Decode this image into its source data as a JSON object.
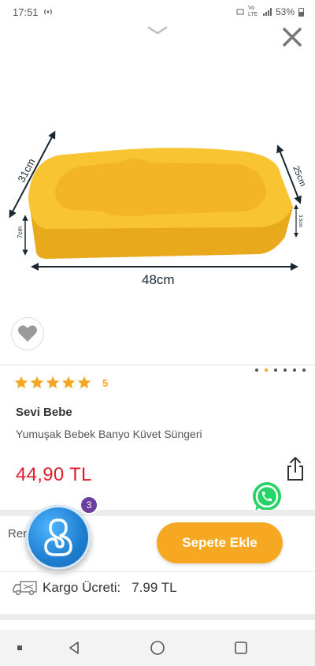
{
  "status_bar": {
    "time": "17:51",
    "network_label": "Vo LTE",
    "battery_percent": "53%"
  },
  "product": {
    "dimensions": {
      "width": "31cm",
      "height": "7cm",
      "length": "48cm",
      "right_depth": "25cm",
      "right_height": "3.5cm"
    },
    "rating_stars": 5,
    "rating_count": "5",
    "brand": "Sevi Bebe",
    "name": "Yumuşak Bebek Banyo Küvet Süngeri",
    "price": "44,90 TL",
    "image_color": "#f8c432"
  },
  "gallery": {
    "total": 6,
    "active_index": 1
  },
  "purchase": {
    "renk_label": "Renk",
    "add_to_cart_label": "Sepete Ekle",
    "assistant_badge": "3"
  },
  "shipping": {
    "label": "Kargo Ücreti:",
    "value": "7.99 TL"
  },
  "colors": {
    "accent": "#f7a823",
    "price": "#e01a2b",
    "whatsapp": "#25d366",
    "badge": "#6b3fa0"
  }
}
